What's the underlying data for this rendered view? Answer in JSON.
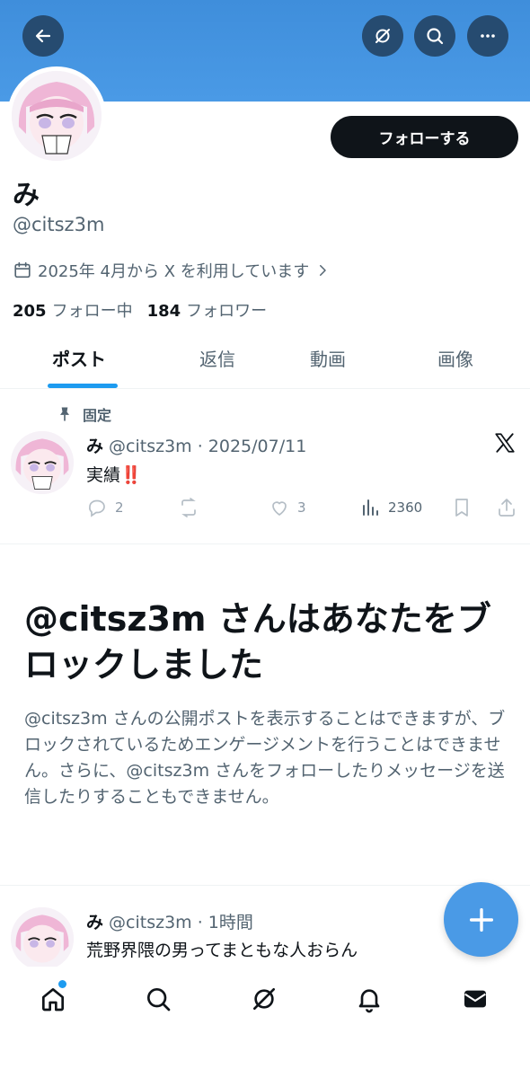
{
  "header": {
    "back_icon": "arrow-left-icon",
    "grok_icon": "grok-slash-icon",
    "search_icon": "search-icon",
    "more_icon": "more-dots-icon",
    "banner_color": "#4a9ae6"
  },
  "profile": {
    "display_name": "み",
    "handle": "@citsz3m",
    "follow_label": "フォローする",
    "joined": "2025年 4月から X を利用しています",
    "following_count": "205",
    "following_label": "フォロー中",
    "followers_count": "184",
    "followers_label": "フォロワー"
  },
  "tabs": [
    {
      "label": "ポスト",
      "active": true
    },
    {
      "label": "返信",
      "active": false
    },
    {
      "label": "動画",
      "active": false
    },
    {
      "label": "画像",
      "active": false
    }
  ],
  "pinned_post": {
    "pinned_label": "固定",
    "name": "み",
    "meta": "@citsz3m · 2025/07/11",
    "text": "実績‼️",
    "replies": "2",
    "likes": "3",
    "views": "2360"
  },
  "blocked_notice": {
    "title": "@citsz3m さんはあなたをブロックしました",
    "body": "@citsz3m さんの公開ポストを表示することはできますが、ブロックされているためエンゲージメントを行うことはできません。さらに、@citsz3m さんをフォローしたりメッセージを送信したりすることもできません。"
  },
  "second_post": {
    "name": "み",
    "meta": "@citsz3m · 1時間",
    "text": "荒野界隈の男ってまともな人おらん"
  },
  "colors": {
    "accent": "#1d9bf0",
    "text_primary": "#0f1419",
    "text_secondary": "#536471",
    "reaction_red": "#e0245e"
  },
  "bottom_nav": [
    "home-icon",
    "search-icon",
    "grok-icon",
    "notifications-icon",
    "messages-icon"
  ]
}
